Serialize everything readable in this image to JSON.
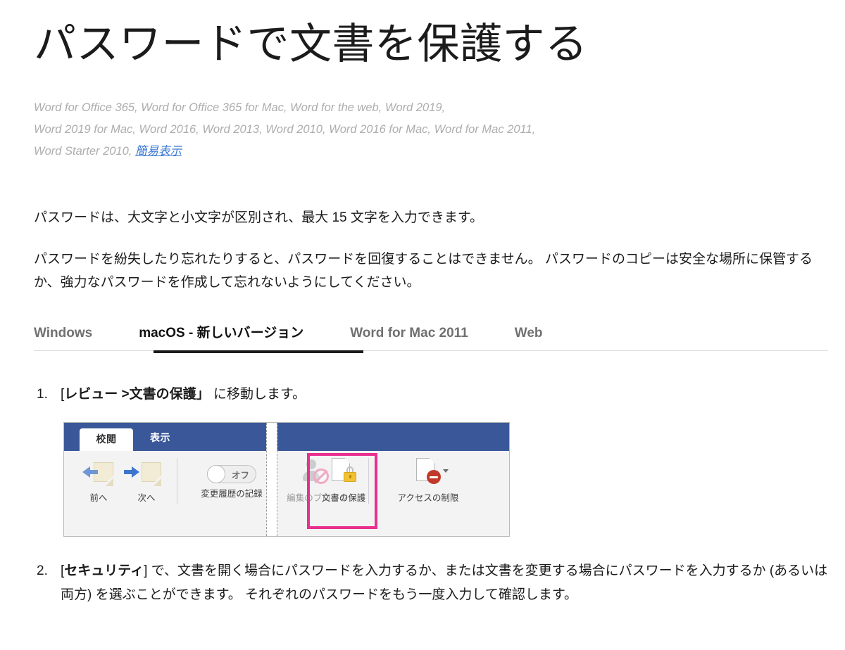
{
  "article": {
    "title": "パスワードで文書を保護する",
    "applies_to_line1": "Word for Office 365, Word for Office 365 for Mac, Word for the web, Word 2019,",
    "applies_to_line2": "Word 2019 for Mac, Word 2016, Word 2013, Word 2010, Word 2016 for Mac, Word for Mac 2011,",
    "applies_to_line3_prefix": "Word Starter 2010, ",
    "applies_to_link": "簡易表示",
    "paragraph_1": "パスワードは、大文字と小文字が区別され、最大 15 文字を入力できます。",
    "paragraph_2": "パスワードを紛失したり忘れたりすると、パスワードを回復することはできません。 パスワードのコピーは安全な場所に保管するか、強力なパスワードを作成して忘れないようにしてください。"
  },
  "tabs": {
    "items": [
      {
        "label": "Windows",
        "active": false
      },
      {
        "label": "macOS - 新しいバージョン",
        "active": true
      },
      {
        "label": "Word for Mac 2011",
        "active": false
      },
      {
        "label": "Web",
        "active": false
      }
    ]
  },
  "steps": [
    {
      "number": "1.",
      "open_bracket": "[",
      "bold_text": "レビュー >文書の保護",
      "close_bracket": "」",
      "tail": " に移動します。"
    },
    {
      "number": "2.",
      "open_bracket": "[",
      "bold_text": "セキュリティ",
      "close_bracket": "]",
      "tail": " で、文書を開く場合にパスワードを入力するか、または文書を変更する場合にパスワードを入力するか (あるいは両方) を選ぶことができます。 それぞれのパスワードをもう一度入力して確認します。"
    }
  ],
  "ribbon": {
    "tab_review": "校閲",
    "tab_view": "表示",
    "items": {
      "previous": "前へ",
      "next": "次へ",
      "track_changes": "変更履歴の記録",
      "track_changes_toggle": "オフ",
      "block_authors": "編集のブロック",
      "protect_document": "文書の保護",
      "restrict_access": "アクセスの制限"
    },
    "colors": {
      "ribbon_blue": "#3a5899",
      "highlight_pink": "#e8308f",
      "lock_yellow": "#f1c232",
      "restrict_red": "#c0392b"
    }
  }
}
